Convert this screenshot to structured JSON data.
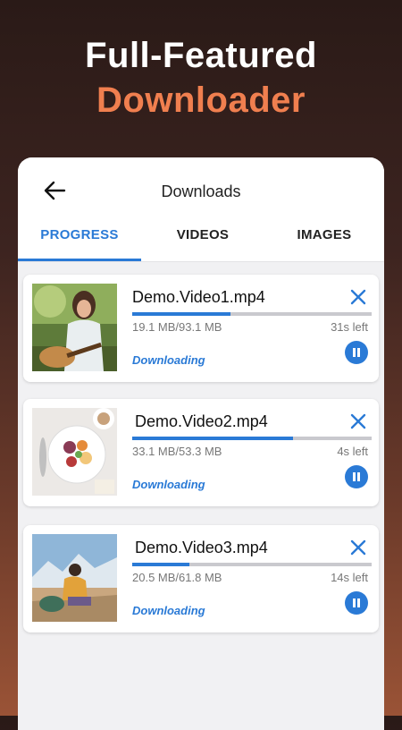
{
  "promo": {
    "line1": "Full-Featured",
    "line2": "Downloader"
  },
  "app": {
    "title": "Downloads",
    "tabs": [
      {
        "label": "PROGRESS",
        "active": true
      },
      {
        "label": "VIDEOS",
        "active": false
      },
      {
        "label": "IMAGES",
        "active": false
      }
    ]
  },
  "downloads": [
    {
      "filename": "Demo.Video1.mp4",
      "size": "19.1 MB/93.1 MB",
      "time_left": "31s left",
      "status": "Downloading",
      "progress": 0.41,
      "thumbnail": "girl-guitar"
    },
    {
      "filename": "Demo.Video2.mp4",
      "size": "33.1 MB/53.3 MB",
      "time_left": "4s left",
      "status": "Downloading",
      "progress": 0.67,
      "thumbnail": "breakfast-plate"
    },
    {
      "filename": "Demo.Video3.mp4",
      "size": "20.5 MB/61.8 MB",
      "time_left": "14s left",
      "status": "Downloading",
      "progress": 0.24,
      "thumbnail": "hiker-mountains"
    }
  ],
  "colors": {
    "accent": "#2a7ad6",
    "promo_orange": "#f07f4f"
  }
}
